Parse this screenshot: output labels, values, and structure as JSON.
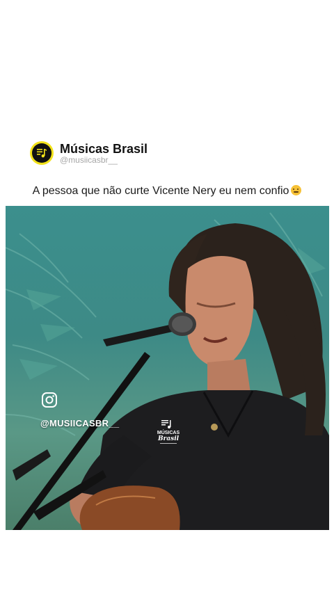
{
  "account": {
    "name": "Músicas Brasil",
    "handle": "@musiicasbr__"
  },
  "caption": {
    "text": "A pessoa que não curte Vicente Nery eu nem confio"
  },
  "video": {
    "overlay_handle": "@MUSIICASBR__",
    "watermark_text": "MÚSICAS BRASIL"
  },
  "colors": {
    "logo_accent": "#f2e21a",
    "backdrop": "#3d8a86"
  },
  "icons": [
    "music-note-icon",
    "emoji-icon",
    "instagram-icon"
  ]
}
